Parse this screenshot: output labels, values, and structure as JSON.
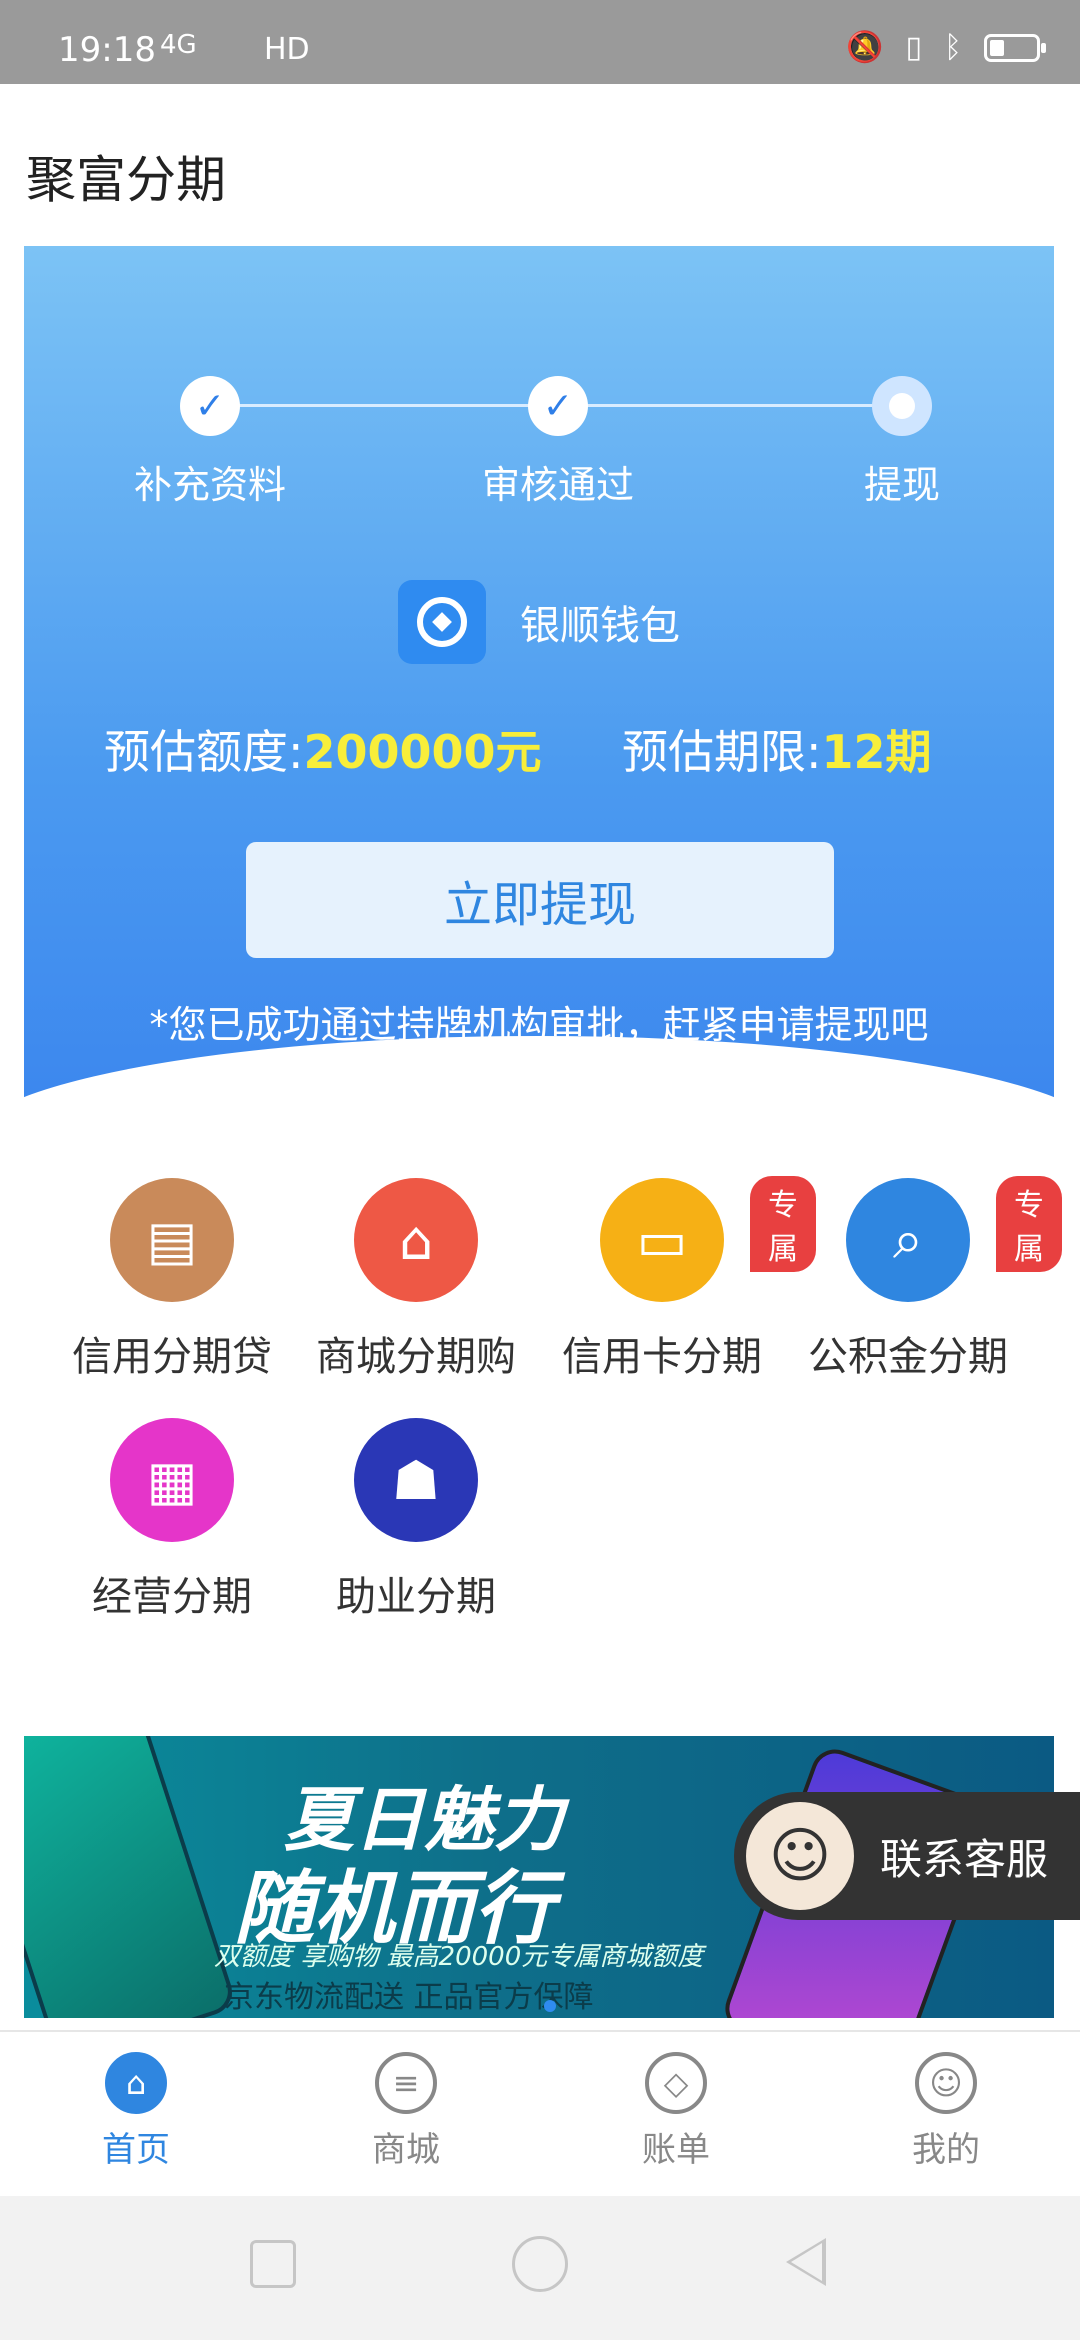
{
  "status_bar": {
    "time": "19:18",
    "signal": "4G",
    "hd": "HD"
  },
  "app": {
    "title": "聚富分期"
  },
  "hero": {
    "steps": [
      {
        "label": "补充资料",
        "state": "done"
      },
      {
        "label": "审核通过",
        "state": "done"
      },
      {
        "label": "提现",
        "state": "current"
      }
    ],
    "wallet_name": "银顺钱包",
    "estimate_amount_label": "预估额度:",
    "estimate_amount_value": "200000元",
    "estimate_term_label": "预估期限:",
    "estimate_term_value": "12期",
    "withdraw_button": "立即提现",
    "note": "*您已成功通过持牌机构审批，赶紧申请提现吧"
  },
  "functions": [
    {
      "label": "信用分期贷",
      "color": "#c98a5a",
      "icon": "document-icon"
    },
    {
      "label": "商城分期购",
      "color": "#ee5845",
      "icon": "store-icon"
    },
    {
      "label": "信用卡分期",
      "color": "#f6b015",
      "icon": "credit-card-icon",
      "badge": "专属"
    },
    {
      "label": "公积金分期",
      "color": "#2f86e0",
      "icon": "house-search-icon",
      "badge": "专属"
    },
    {
      "label": "经营分期",
      "color": "#e535c9",
      "icon": "gold-bars-icon"
    },
    {
      "label": "助业分期",
      "color": "#2a37b6",
      "icon": "money-bag-icon"
    }
  ],
  "banner": {
    "title1": "夏日魅力",
    "title2": "随机而行",
    "subtitle": "双额度 享购物 最高20000元专属商城额度",
    "footer": "京东物流配送 正品官方保障"
  },
  "service": {
    "label": "联系客服"
  },
  "tabs": [
    {
      "label": "首页",
      "icon": "home-icon"
    },
    {
      "label": "商城",
      "icon": "list-icon"
    },
    {
      "label": "账单",
      "icon": "tag-icon"
    },
    {
      "label": "我的",
      "icon": "user-icon"
    }
  ],
  "colors": {
    "primary": "#2f86e0",
    "highlight": "#f8ee3a",
    "badge": "#e84040"
  }
}
